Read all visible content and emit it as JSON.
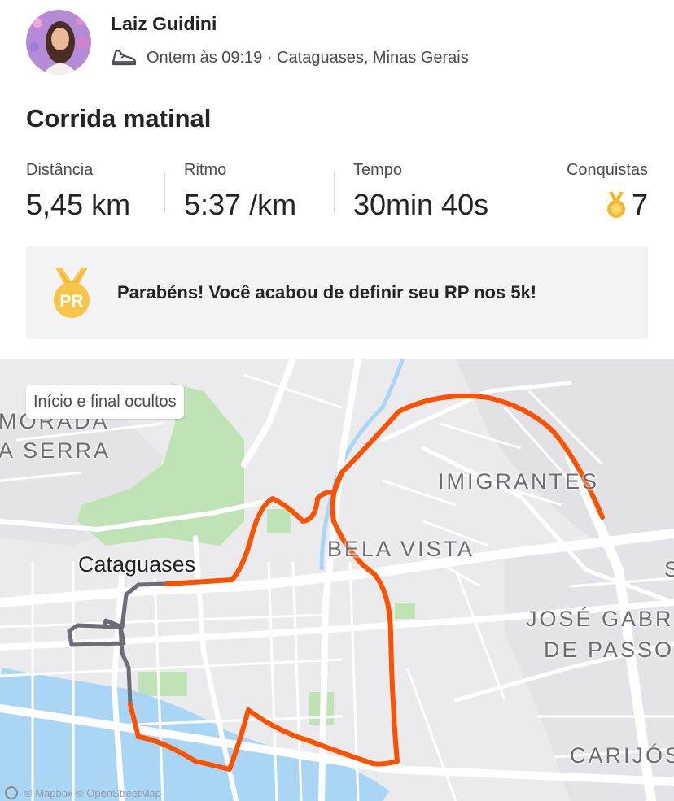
{
  "athlete": {
    "name": "Laiz Guidini",
    "activity_meta": "Ontem às 09:19 · Cataguases, Minas Gerais"
  },
  "activity": {
    "title": "Corrida matinal"
  },
  "stats": {
    "distance_label": "Distância",
    "distance_value": "5,45 km",
    "pace_label": "Ritmo",
    "pace_value": "5:37 /km",
    "time_label": "Tempo",
    "time_value": "30min 40s",
    "achievements_label": "Conquistas",
    "achievements_value": "7"
  },
  "pr_banner": {
    "text": "Parabéns! Você acabou de definir seu RP nos 5k!",
    "badge_text": "PR"
  },
  "map": {
    "privacy_chip": "Início e final ocultos",
    "labels": {
      "morada": "MORADA",
      "serra": "A SERRA",
      "city": "Cataguases",
      "imigrantes": "IMIGRANTES",
      "bela_vista": "BELA VISTA",
      "jose_gabriel": "JOSÉ GABRI",
      "de_passos": "DE PASSOS",
      "carijos": "CARIJÓS",
      "edge_s": "S"
    },
    "attribution": "© Mapbox © OpenStreetMap",
    "route_color": "#fc5200",
    "hidden_route_color": "#6d6d78",
    "river_color": "#a9d6f5",
    "park_color": "#bfe3b4"
  },
  "colors": {
    "accent": "#fc5200",
    "medal_gold": "#f5b731",
    "text_primary": "#242428",
    "text_secondary": "#4a4a52"
  }
}
